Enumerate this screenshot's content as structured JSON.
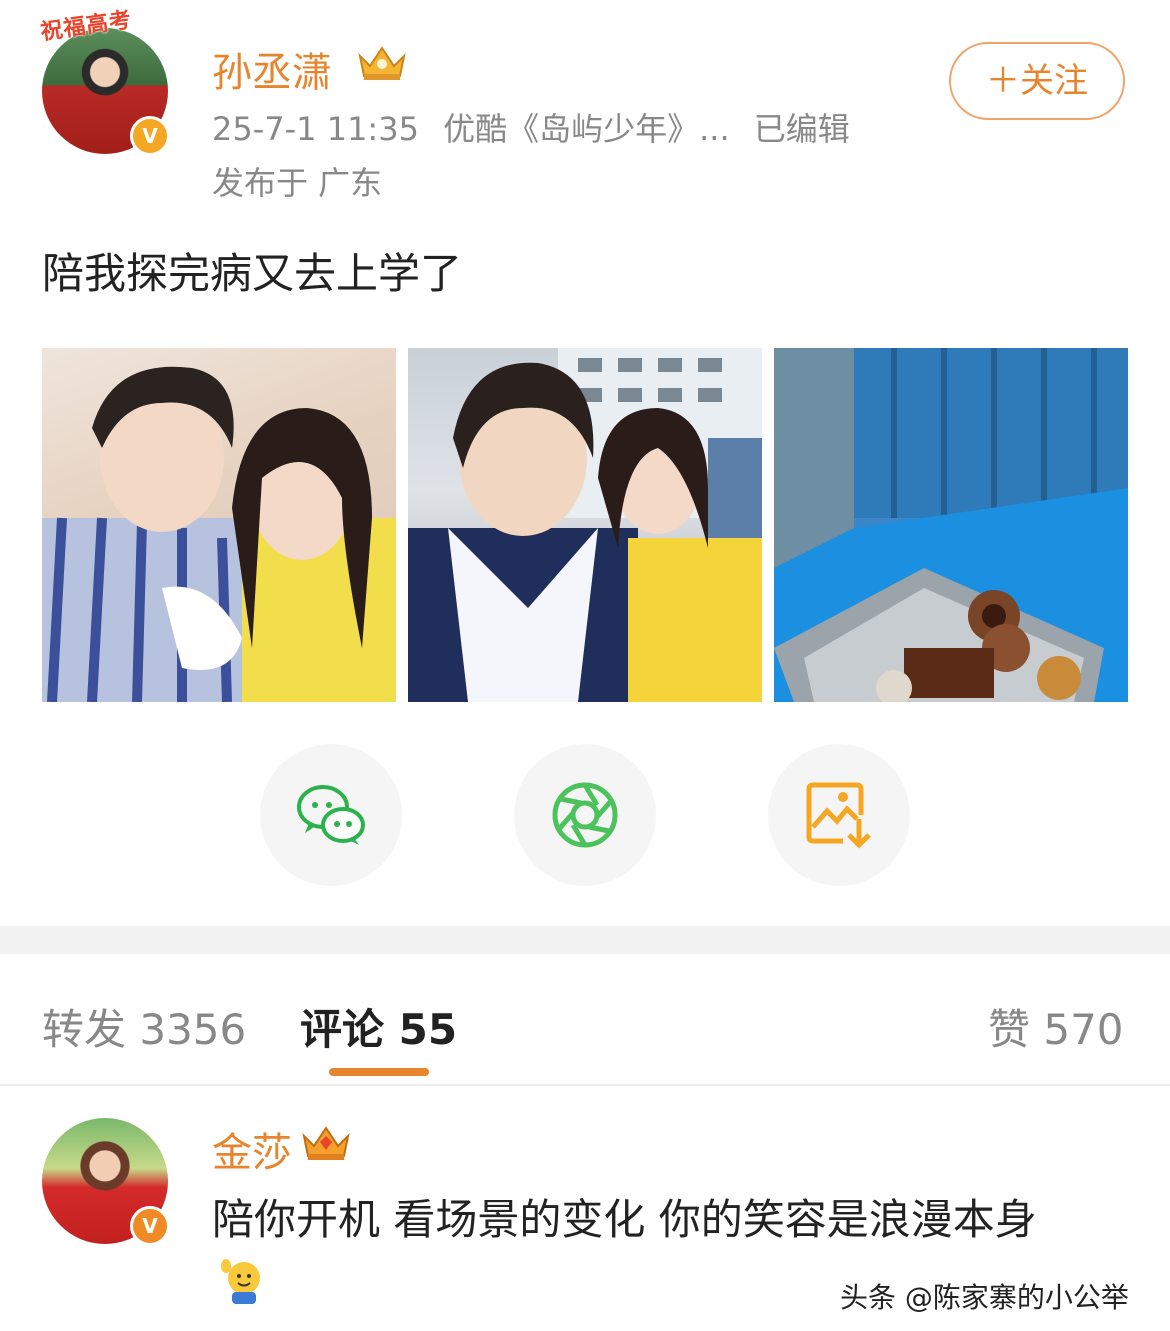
{
  "post": {
    "avatar_ribbon": "祝福高考",
    "username": "孙丞潇",
    "follow_label": "＋关注",
    "timestamp": "25-7-1 11:35",
    "source": "优酷《岛屿少年》...",
    "edited": "已编辑",
    "location": "发布于 广东",
    "text": "陪我探完病又去上学了",
    "photo_count": 3
  },
  "share": {
    "icons": [
      "wechat-icon",
      "moments-icon",
      "save-image-icon"
    ],
    "colors": {
      "wechat": "#2bb24c",
      "moments": "#4cc25c",
      "save": "#f5a623"
    }
  },
  "tabs": {
    "repost_label": "转发 3356",
    "comment_label": "评论 55",
    "like_label": "赞 570"
  },
  "comment": {
    "username": "金莎",
    "text": "陪你开机 看场景的变化 你的笑容是浪漫本身"
  },
  "watermark": "头条 @陈家寨的小公举",
  "colors": {
    "accent": "#e8842c",
    "muted": "#888888",
    "divider": "#f2f2f2"
  }
}
